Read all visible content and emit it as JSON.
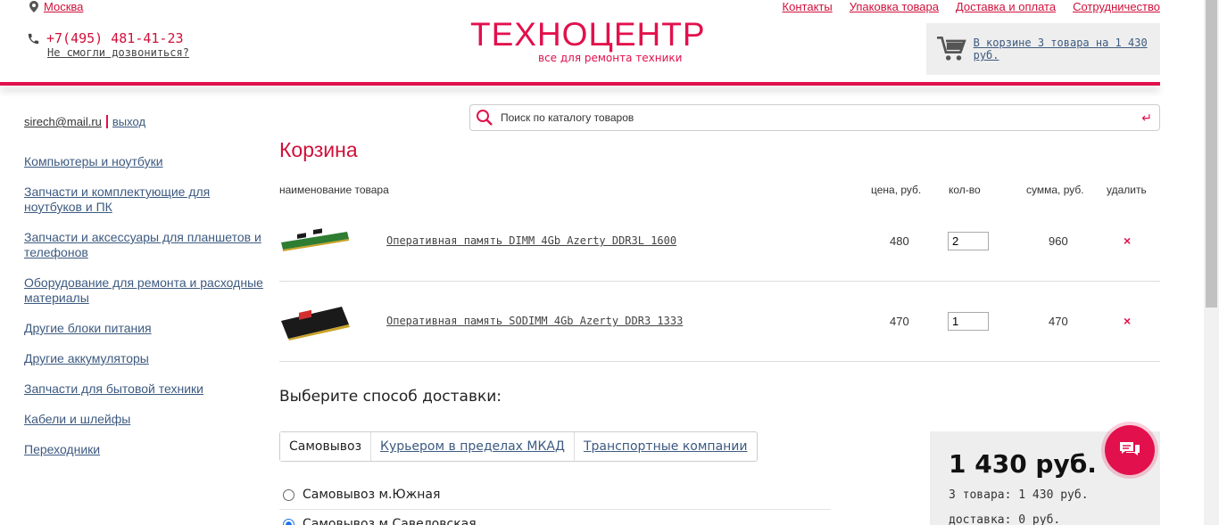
{
  "header": {
    "city": "Москва",
    "phone": "+7(495) 481-41-23",
    "callback": "Не смогли дозвониться?",
    "logo": "ТЕХНОЦЕНТР",
    "slogan": "все для ремонта техники",
    "nav": [
      "Контакты",
      "Упаковка товара",
      "Доставка и оплата",
      "Сотрудничество"
    ],
    "cart_text": "В корзине 3 товара на 1 430 руб."
  },
  "user": {
    "email": "sirech@mail.ru",
    "logout": "выход"
  },
  "categories": [
    "Компьютеры и ноутбуки",
    "Запчасти и комплектующие для ноутбуков и ПК",
    "Запчасти и аксессуары для планшетов и телефонов",
    "Оборудование для ремонта и расходные материалы",
    "Другие блоки питания",
    "Другие аккумуляторы",
    "Запчасти для бытовой техники",
    "Кабели и шлейфы",
    "Переходники"
  ],
  "search": {
    "placeholder": "Поиск по каталогу товаров"
  },
  "cart": {
    "title": "Корзина",
    "columns": {
      "name": "наименование товара",
      "price": "цена, руб.",
      "qty": "кол-во",
      "sum": "сумма, руб.",
      "delete": "удалить"
    },
    "items": [
      {
        "name": "Оперативная память DIMM 4Gb Azerty DDR3L 1600",
        "price": "480",
        "qty": "2",
        "sum": "960",
        "delete": "×"
      },
      {
        "name": "Оперативная память SODIMM 4Gb Azerty DDR3 1333",
        "price": "470",
        "qty": "1",
        "sum": "470",
        "delete": "×"
      }
    ]
  },
  "delivery": {
    "heading": "Выберите способ доставки:",
    "tabs": [
      "Самовывоз",
      "Курьером в пределах МКАД",
      "Транспортные компании"
    ],
    "options": [
      "Самовывоз м.Южная",
      "Самовывоз м.Савеловская"
    ]
  },
  "summary": {
    "total": "1 430 руб.",
    "items": "3 товара: 1 430 руб.",
    "delivery": "доставка: 0 руб."
  }
}
